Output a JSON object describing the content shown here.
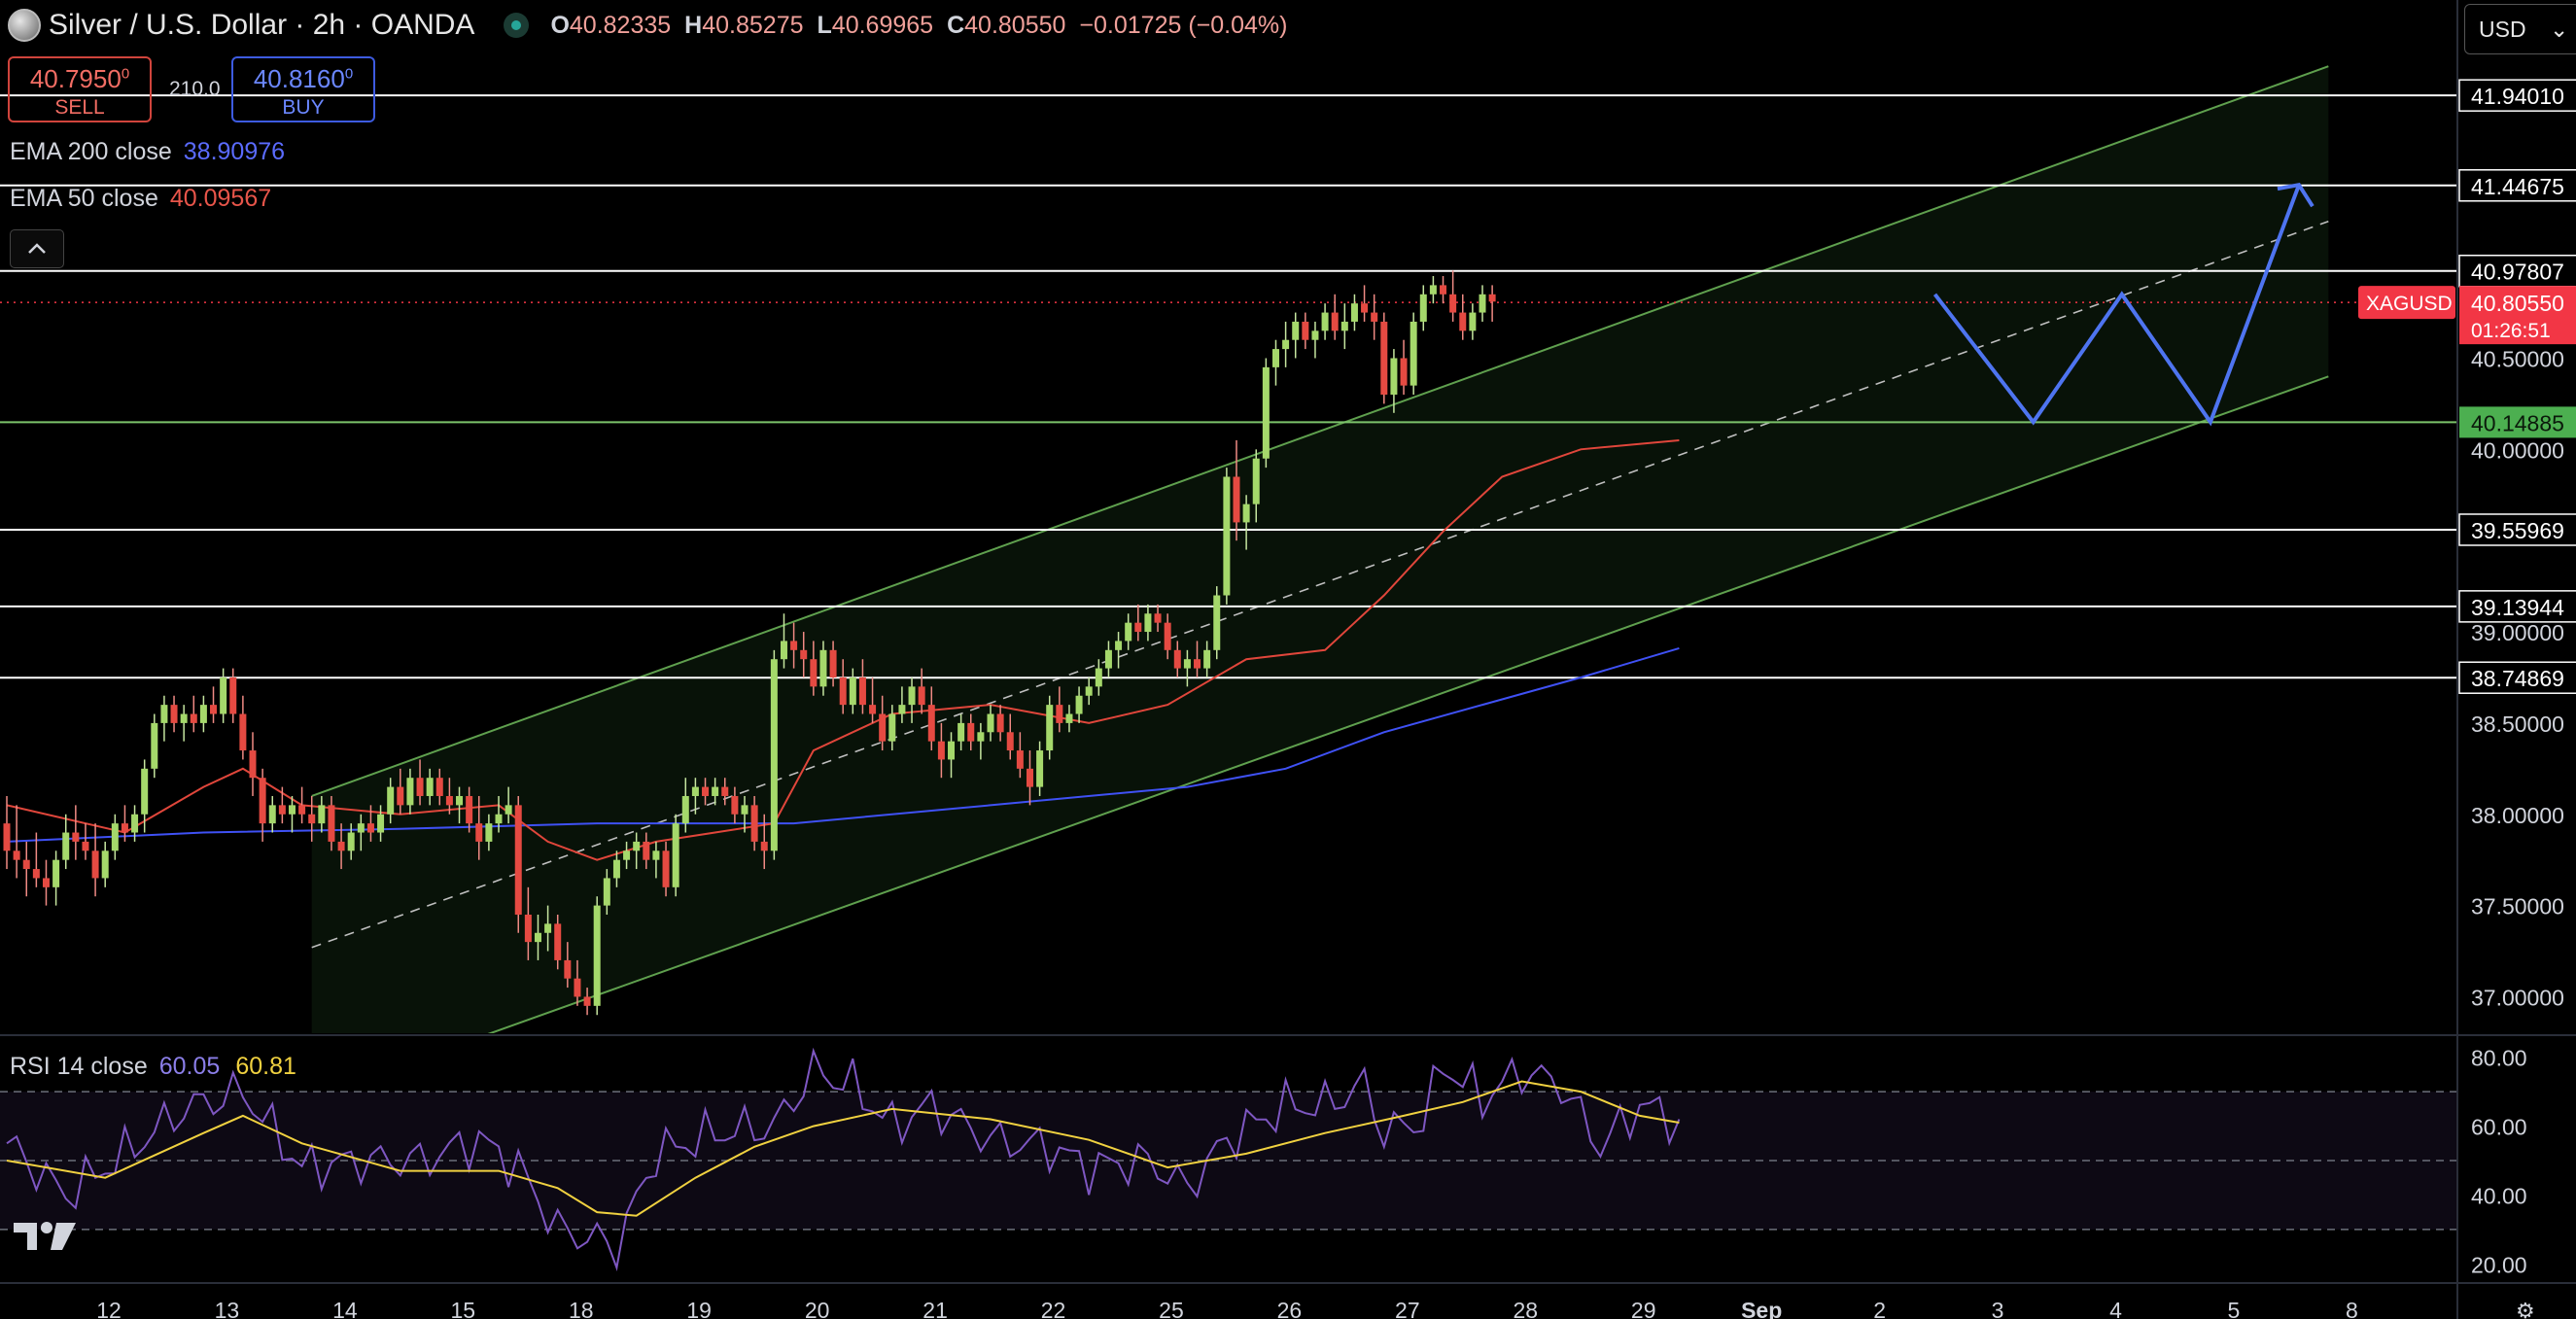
{
  "header": {
    "title": "Silver / U.S. Dollar · 2h · OANDA",
    "open_label": "O",
    "open": "40.82335",
    "high_label": "H",
    "high": "40.85275",
    "low_label": "L",
    "low": "40.69965",
    "close_label": "C",
    "close": "40.80550",
    "change": "−0.01725 (−0.04%)"
  },
  "trade": {
    "sell_price": "40.7950",
    "sell_price_sup": "0",
    "sell_label": "SELL",
    "spread": "210.0",
    "buy_price": "40.8160",
    "buy_price_sup": "0",
    "buy_label": "BUY"
  },
  "indicators": {
    "ema200_name": "EMA 200 close",
    "ema200_value": "38.90976",
    "ema50_name": "EMA 50 close",
    "ema50_value": "40.09567",
    "rsi_name": "RSI 14 close",
    "rsi_value": "60.05",
    "rsi_ma_value": "60.81"
  },
  "currency": {
    "selected": "USD",
    "caret": "⌄"
  },
  "icons": {
    "collapse": "chevron-up-icon",
    "settings": "gear-icon",
    "logo": "tradingview-logo"
  },
  "chart_data": {
    "type": "candlestick",
    "symbol": "XAGUSD",
    "interval": "2h",
    "price_axis": {
      "min": 36.8,
      "max": 42.25,
      "ticks": [
        "37.00000",
        "37.50000",
        "38.00000",
        "38.50000",
        "39.00000",
        "40.00000",
        "40.50000"
      ],
      "tick_values": [
        37.0,
        37.5,
        38.0,
        38.5,
        39.0,
        40.0,
        40.5
      ]
    },
    "rsi_axis": {
      "min": 15,
      "max": 85,
      "ticks": [
        "80.00",
        "60.00",
        "40.00",
        "20.00"
      ],
      "tick_values": [
        80,
        60,
        40,
        20
      ],
      "upper_band": 70,
      "middle": 50,
      "lower_band": 30
    },
    "time_axis": {
      "labels": [
        "12",
        "13",
        "14",
        "15",
        "18",
        "19",
        "20",
        "21",
        "22",
        "25",
        "26",
        "27",
        "28",
        "29",
        "Sep",
        "2",
        "3",
        "4",
        "5",
        "8"
      ],
      "label_positions": [
        0,
        12,
        24,
        36,
        48,
        60,
        72,
        84,
        96,
        108,
        120,
        132,
        144,
        156,
        168,
        180,
        192,
        204,
        216,
        228
      ],
      "bold_label": "Sep"
    },
    "levels": [
      {
        "value": 41.9401,
        "label": "41.94010",
        "color": "#ffffff"
      },
      {
        "value": 41.44675,
        "label": "41.44675",
        "color": "#ffffff"
      },
      {
        "value": 40.97807,
        "label": "40.97807",
        "color": "#ffffff"
      },
      {
        "value": 40.14885,
        "label": "40.14885",
        "color": "#7cc36b",
        "badge": true
      },
      {
        "value": 39.55969,
        "label": "39.55969",
        "color": "#ffffff"
      },
      {
        "value": 39.13944,
        "label": "39.13944",
        "color": "#ffffff"
      },
      {
        "value": 38.74869,
        "label": "38.74869",
        "color": "#ffffff"
      }
    ],
    "last_price": {
      "value": 40.8055,
      "label": "40.80550",
      "countdown": "01:26:51",
      "symbol_tag": "XAGUSD",
      "color": "#f23645"
    },
    "channel": {
      "start_index": 31,
      "end_index": 236,
      "lower_start": 36.45,
      "lower_end": 40.4,
      "upper_start": 38.1,
      "upper_end": 42.1,
      "mid_start": 37.27,
      "mid_end": 41.25,
      "fill": "rgba(76,175,80,0.10)",
      "line": "#5fa04e"
    },
    "projection": {
      "color": "#4e74f0",
      "points": [
        [
          196,
          40.85
        ],
        [
          206,
          40.15
        ],
        [
          215,
          40.85
        ],
        [
          224,
          40.15
        ],
        [
          233,
          41.45
        ]
      ]
    },
    "candles": [
      [
        37.95,
        38.1,
        37.7,
        37.8
      ],
      [
        37.8,
        38.05,
        37.65,
        37.75
      ],
      [
        37.75,
        37.85,
        37.55,
        37.7
      ],
      [
        37.7,
        37.9,
        37.6,
        37.65
      ],
      [
        37.65,
        37.75,
        37.5,
        37.6
      ],
      [
        37.6,
        37.8,
        37.5,
        37.75
      ],
      [
        37.75,
        38.0,
        37.7,
        37.9
      ],
      [
        37.9,
        38.05,
        37.75,
        37.85
      ],
      [
        37.85,
        37.95,
        37.75,
        37.8
      ],
      [
        37.8,
        37.95,
        37.55,
        37.65
      ],
      [
        37.65,
        37.85,
        37.6,
        37.8
      ],
      [
        37.8,
        38.0,
        37.75,
        37.95
      ],
      [
        37.95,
        38.05,
        37.85,
        37.9
      ],
      [
        37.9,
        38.05,
        37.85,
        38.0
      ],
      [
        38.0,
        38.3,
        37.9,
        38.25
      ],
      [
        38.25,
        38.55,
        38.2,
        38.5
      ],
      [
        38.5,
        38.65,
        38.4,
        38.6
      ],
      [
        38.6,
        38.65,
        38.45,
        38.5
      ],
      [
        38.5,
        38.6,
        38.4,
        38.55
      ],
      [
        38.55,
        38.65,
        38.45,
        38.5
      ],
      [
        38.5,
        38.65,
        38.45,
        38.6
      ],
      [
        38.6,
        38.7,
        38.5,
        38.55
      ],
      [
        38.55,
        38.8,
        38.5,
        38.75
      ],
      [
        38.75,
        38.8,
        38.5,
        38.55
      ],
      [
        38.55,
        38.65,
        38.3,
        38.35
      ],
      [
        38.35,
        38.45,
        38.1,
        38.2
      ],
      [
        38.2,
        38.25,
        37.85,
        37.95
      ],
      [
        37.95,
        38.1,
        37.9,
        38.05
      ],
      [
        38.05,
        38.15,
        37.95,
        38.0
      ],
      [
        38.0,
        38.1,
        37.9,
        38.05
      ],
      [
        38.05,
        38.15,
        37.95,
        38.0
      ],
      [
        38.0,
        38.1,
        37.85,
        37.95
      ],
      [
        37.95,
        38.1,
        37.9,
        38.05
      ],
      [
        38.05,
        38.1,
        37.8,
        37.85
      ],
      [
        37.85,
        37.95,
        37.7,
        37.8
      ],
      [
        37.8,
        37.95,
        37.75,
        37.9
      ],
      [
        37.9,
        38.0,
        37.8,
        37.95
      ],
      [
        37.95,
        38.05,
        37.85,
        37.9
      ],
      [
        37.9,
        38.05,
        37.85,
        38.0
      ],
      [
        38.0,
        38.2,
        37.95,
        38.15
      ],
      [
        38.15,
        38.25,
        38.0,
        38.05
      ],
      [
        38.05,
        38.25,
        38.0,
        38.2
      ],
      [
        38.2,
        38.3,
        38.05,
        38.1
      ],
      [
        38.1,
        38.25,
        38.05,
        38.2
      ],
      [
        38.2,
        38.25,
        38.05,
        38.1
      ],
      [
        38.1,
        38.2,
        38.0,
        38.05
      ],
      [
        38.05,
        38.15,
        37.95,
        38.1
      ],
      [
        38.1,
        38.15,
        37.9,
        37.95
      ],
      [
        37.95,
        38.1,
        37.75,
        37.85
      ],
      [
        37.85,
        38.0,
        37.8,
        37.95
      ],
      [
        37.95,
        38.1,
        37.9,
        38.0
      ],
      [
        38.0,
        38.15,
        37.95,
        38.05
      ],
      [
        38.05,
        38.1,
        37.35,
        37.45
      ],
      [
        37.45,
        37.6,
        37.2,
        37.3
      ],
      [
        37.3,
        37.45,
        37.2,
        37.35
      ],
      [
        37.35,
        37.5,
        37.25,
        37.4
      ],
      [
        37.4,
        37.45,
        37.15,
        37.2
      ],
      [
        37.2,
        37.3,
        37.05,
        37.1
      ],
      [
        37.1,
        37.2,
        36.95,
        37.0
      ],
      [
        37.0,
        37.05,
        36.9,
        36.95
      ],
      [
        36.95,
        37.55,
        36.9,
        37.5
      ],
      [
        37.5,
        37.7,
        37.45,
        37.65
      ],
      [
        37.65,
        37.8,
        37.6,
        37.75
      ],
      [
        37.75,
        37.85,
        37.7,
        37.8
      ],
      [
        37.8,
        37.9,
        37.7,
        37.85
      ],
      [
        37.85,
        37.9,
        37.7,
        37.75
      ],
      [
        37.75,
        37.85,
        37.65,
        37.8
      ],
      [
        37.8,
        37.85,
        37.55,
        37.6
      ],
      [
        37.6,
        38.0,
        37.55,
        37.95
      ],
      [
        37.95,
        38.2,
        37.9,
        38.1
      ],
      [
        38.1,
        38.2,
        38.0,
        38.15
      ],
      [
        38.15,
        38.2,
        38.05,
        38.1
      ],
      [
        38.1,
        38.2,
        38.05,
        38.15
      ],
      [
        38.15,
        38.2,
        38.05,
        38.1
      ],
      [
        38.1,
        38.15,
        37.95,
        38.0
      ],
      [
        38.0,
        38.1,
        37.9,
        38.05
      ],
      [
        38.05,
        38.1,
        37.8,
        37.85
      ],
      [
        37.85,
        38.0,
        37.7,
        37.8
      ],
      [
        37.8,
        38.9,
        37.75,
        38.85
      ],
      [
        38.85,
        39.1,
        38.8,
        38.95
      ],
      [
        38.95,
        39.05,
        38.8,
        38.9
      ],
      [
        38.9,
        39.0,
        38.75,
        38.85
      ],
      [
        38.85,
        38.95,
        38.65,
        38.7
      ],
      [
        38.7,
        38.95,
        38.65,
        38.9
      ],
      [
        38.9,
        38.95,
        38.7,
        38.75
      ],
      [
        38.75,
        38.85,
        38.55,
        38.6
      ],
      [
        38.6,
        38.8,
        38.55,
        38.75
      ],
      [
        38.75,
        38.85,
        38.55,
        38.6
      ],
      [
        38.6,
        38.75,
        38.5,
        38.55
      ],
      [
        38.55,
        38.65,
        38.35,
        38.4
      ],
      [
        38.4,
        38.6,
        38.35,
        38.55
      ],
      [
        38.55,
        38.7,
        38.5,
        38.6
      ],
      [
        38.6,
        38.75,
        38.5,
        38.7
      ],
      [
        38.7,
        38.8,
        38.55,
        38.6
      ],
      [
        38.6,
        38.7,
        38.35,
        38.4
      ],
      [
        38.4,
        38.5,
        38.2,
        38.3
      ],
      [
        38.3,
        38.45,
        38.2,
        38.4
      ],
      [
        38.4,
        38.55,
        38.35,
        38.5
      ],
      [
        38.5,
        38.55,
        38.35,
        38.4
      ],
      [
        38.4,
        38.5,
        38.3,
        38.45
      ],
      [
        38.45,
        38.6,
        38.4,
        38.55
      ],
      [
        38.55,
        38.6,
        38.4,
        38.45
      ],
      [
        38.45,
        38.55,
        38.3,
        38.35
      ],
      [
        38.35,
        38.45,
        38.2,
        38.25
      ],
      [
        38.25,
        38.35,
        38.05,
        38.15
      ],
      [
        38.15,
        38.4,
        38.1,
        38.35
      ],
      [
        38.35,
        38.65,
        38.3,
        38.6
      ],
      [
        38.6,
        38.7,
        38.45,
        38.5
      ],
      [
        38.5,
        38.6,
        38.45,
        38.55
      ],
      [
        38.55,
        38.7,
        38.5,
        38.65
      ],
      [
        38.65,
        38.75,
        38.6,
        38.7
      ],
      [
        38.7,
        38.85,
        38.65,
        38.8
      ],
      [
        38.8,
        38.95,
        38.75,
        38.9
      ],
      [
        38.9,
        39.0,
        38.8,
        38.95
      ],
      [
        38.95,
        39.1,
        38.9,
        39.05
      ],
      [
        39.05,
        39.15,
        38.95,
        39.0
      ],
      [
        39.0,
        39.15,
        38.95,
        39.1
      ],
      [
        39.1,
        39.15,
        39.0,
        39.05
      ],
      [
        39.05,
        39.1,
        38.85,
        38.9
      ],
      [
        38.9,
        38.95,
        38.75,
        38.8
      ],
      [
        38.8,
        38.9,
        38.7,
        38.85
      ],
      [
        38.85,
        38.95,
        38.75,
        38.8
      ],
      [
        38.8,
        38.95,
        38.75,
        38.9
      ],
      [
        38.9,
        39.25,
        38.85,
        39.2
      ],
      [
        39.2,
        39.9,
        39.15,
        39.85
      ],
      [
        39.85,
        40.05,
        39.5,
        39.6
      ],
      [
        39.6,
        39.75,
        39.45,
        39.7
      ],
      [
        39.7,
        40.0,
        39.6,
        39.95
      ],
      [
        39.95,
        40.5,
        39.9,
        40.45
      ],
      [
        40.45,
        40.6,
        40.35,
        40.55
      ],
      [
        40.55,
        40.7,
        40.45,
        40.6
      ],
      [
        40.6,
        40.75,
        40.5,
        40.7
      ],
      [
        40.7,
        40.75,
        40.55,
        40.6
      ],
      [
        40.6,
        40.7,
        40.5,
        40.65
      ],
      [
        40.65,
        40.8,
        40.6,
        40.75
      ],
      [
        40.75,
        40.85,
        40.6,
        40.65
      ],
      [
        40.65,
        40.8,
        40.55,
        40.7
      ],
      [
        40.7,
        40.85,
        40.65,
        40.8
      ],
      [
        40.8,
        40.9,
        40.7,
        40.75
      ],
      [
        40.75,
        40.85,
        40.6,
        40.7
      ],
      [
        40.7,
        40.75,
        40.25,
        40.3
      ],
      [
        40.3,
        40.55,
        40.2,
        40.5
      ],
      [
        40.5,
        40.6,
        40.3,
        40.35
      ],
      [
        40.35,
        40.75,
        40.3,
        40.7
      ],
      [
        40.7,
        40.9,
        40.65,
        40.85
      ],
      [
        40.85,
        40.95,
        40.8,
        40.9
      ],
      [
        40.9,
        40.95,
        40.8,
        40.85
      ],
      [
        40.85,
        40.98,
        40.7,
        40.75
      ],
      [
        40.75,
        40.85,
        40.6,
        40.65
      ],
      [
        40.65,
        40.8,
        40.6,
        40.75
      ],
      [
        40.75,
        40.9,
        40.7,
        40.85
      ],
      [
        40.85,
        40.9,
        40.7,
        40.81
      ]
    ],
    "ema50": [
      [
        0,
        38.05
      ],
      [
        12,
        37.9
      ],
      [
        20,
        38.15
      ],
      [
        24,
        38.25
      ],
      [
        30,
        38.05
      ],
      [
        40,
        38.0
      ],
      [
        50,
        38.05
      ],
      [
        55,
        37.85
      ],
      [
        60,
        37.75
      ],
      [
        66,
        37.85
      ],
      [
        72,
        37.9
      ],
      [
        78,
        37.95
      ],
      [
        82,
        38.35
      ],
      [
        90,
        38.55
      ],
      [
        100,
        38.6
      ],
      [
        110,
        38.5
      ],
      [
        118,
        38.6
      ],
      [
        126,
        38.85
      ],
      [
        134,
        38.9
      ],
      [
        140,
        39.2
      ],
      [
        146,
        39.55
      ],
      [
        152,
        39.85
      ],
      [
        160,
        40.0
      ],
      [
        170,
        40.05
      ]
    ],
    "ema200": [
      [
        0,
        37.85
      ],
      [
        20,
        37.9
      ],
      [
        40,
        37.92
      ],
      [
        60,
        37.95
      ],
      [
        80,
        37.95
      ],
      [
        100,
        38.05
      ],
      [
        120,
        38.15
      ],
      [
        130,
        38.25
      ],
      [
        140,
        38.45
      ],
      [
        150,
        38.6
      ],
      [
        160,
        38.75
      ],
      [
        170,
        38.91
      ]
    ],
    "rsi": [
      [
        0,
        55
      ],
      [
        6,
        40
      ],
      [
        12,
        52
      ],
      [
        18,
        65
      ],
      [
        24,
        70
      ],
      [
        30,
        48
      ],
      [
        36,
        50
      ],
      [
        42,
        50
      ],
      [
        48,
        56
      ],
      [
        52,
        48
      ],
      [
        56,
        30
      ],
      [
        60,
        27
      ],
      [
        62,
        25
      ],
      [
        66,
        52
      ],
      [
        72,
        58
      ],
      [
        78,
        60
      ],
      [
        82,
        76
      ],
      [
        86,
        72
      ],
      [
        90,
        60
      ],
      [
        94,
        66
      ],
      [
        100,
        56
      ],
      [
        106,
        54
      ],
      [
        110,
        48
      ],
      [
        116,
        50
      ],
      [
        120,
        42
      ],
      [
        124,
        56
      ],
      [
        130,
        66
      ],
      [
        134,
        66
      ],
      [
        138,
        72
      ],
      [
        140,
        58
      ],
      [
        144,
        62
      ],
      [
        146,
        78
      ],
      [
        150,
        68
      ],
      [
        154,
        76
      ],
      [
        158,
        72
      ],
      [
        162,
        54
      ],
      [
        166,
        66
      ],
      [
        170,
        62
      ]
    ],
    "rsi_ma": [
      [
        0,
        50
      ],
      [
        10,
        45
      ],
      [
        20,
        58
      ],
      [
        24,
        63
      ],
      [
        30,
        55
      ],
      [
        40,
        47
      ],
      [
        50,
        47
      ],
      [
        56,
        42
      ],
      [
        60,
        35
      ],
      [
        64,
        34
      ],
      [
        70,
        45
      ],
      [
        76,
        54
      ],
      [
        82,
        60
      ],
      [
        90,
        65
      ],
      [
        100,
        62
      ],
      [
        110,
        56
      ],
      [
        118,
        48
      ],
      [
        126,
        52
      ],
      [
        134,
        58
      ],
      [
        142,
        63
      ],
      [
        148,
        67
      ],
      [
        154,
        73
      ],
      [
        160,
        70
      ],
      [
        166,
        63
      ],
      [
        170,
        61
      ]
    ]
  }
}
